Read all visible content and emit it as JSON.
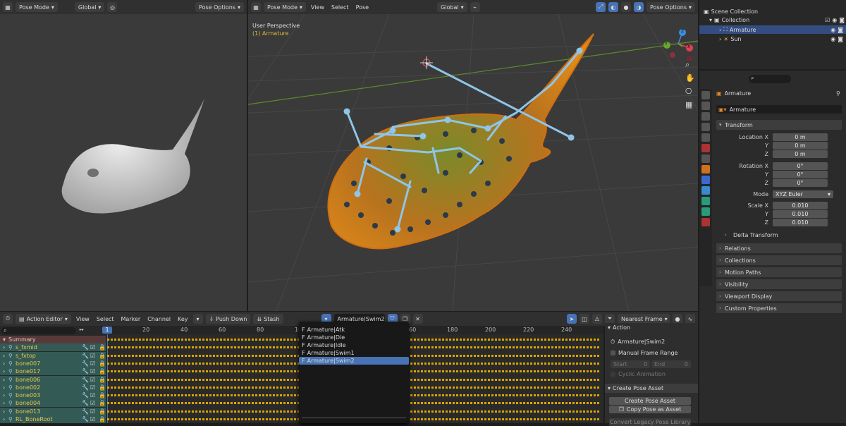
{
  "left_header": {
    "mode": "Pose Mode",
    "orientation": "Global",
    "pose_options": "Pose Options"
  },
  "main_header": {
    "mode": "Pose Mode",
    "menus": [
      "View",
      "Select",
      "Pose"
    ],
    "orientation": "Global",
    "pose_options": "Pose Options"
  },
  "viewport": {
    "perspective": "User Perspective",
    "object": "(1) Armature"
  },
  "gizmo": {
    "x": "X",
    "y": "Y",
    "z": "Z"
  },
  "outliner": {
    "scene_collection": "Scene Collection",
    "collection": "Collection",
    "items": [
      {
        "label": "Armature"
      },
      {
        "label": "Sun"
      }
    ]
  },
  "properties": {
    "object_name": "Armature",
    "data_name": "Armature",
    "transform_title": "Transform",
    "location": {
      "label_x": "Location X",
      "label_y": "Y",
      "label_z": "Z",
      "x": "0 m",
      "y": "0 m",
      "z": "0 m"
    },
    "rotation": {
      "label_x": "Rotation X",
      "label_y": "Y",
      "label_z": "Z",
      "x": "0°",
      "y": "0°",
      "z": "0°"
    },
    "mode_label": "Mode",
    "mode_value": "XYZ Euler",
    "scale": {
      "label_x": "Scale X",
      "label_y": "Y",
      "label_z": "Z",
      "x": "0.010",
      "y": "0.010",
      "z": "0.010"
    },
    "delta_transform": "Delta Transform",
    "panels": [
      "Relations",
      "Collections",
      "Motion Paths",
      "Visibility",
      "Viewport Display",
      "Custom Properties"
    ]
  },
  "action_editor": {
    "editor": "Action Editor",
    "menus": [
      "View",
      "Select",
      "Marker",
      "Channel",
      "Key"
    ],
    "push_down": "Push Down",
    "stash": "Stash",
    "action_name": "Armature|Swim2",
    "snap": "Nearest Frame",
    "current_frame": "1",
    "ticks": [
      "20",
      "40",
      "60",
      "80",
      "10",
      "60",
      "180",
      "200",
      "220",
      "240"
    ],
    "channels": [
      "Summary",
      "s_fxmid",
      "s_fxtop",
      "bone007",
      "bone017",
      "bone006",
      "bone002",
      "bone003",
      "bone004",
      "bone013",
      "RL_BoneRoot"
    ],
    "dropdown": [
      "Armature|Atk",
      "Armature|Die",
      "Armature|Idle",
      "Armature|Swim1",
      "Armature|Swim2"
    ],
    "dropdown_prefix": "F"
  },
  "sidebar": {
    "action_title": "Action",
    "action_name": "Armature|Swim2",
    "manual_range": "Manual Frame Range",
    "start_label": "Start",
    "start_value": "0",
    "end_label": "End",
    "end_value": "0",
    "cyclic": "Cyclic Animation",
    "pose_asset_title": "Create Pose Asset",
    "create_pose": "Create Pose Asset",
    "copy_pose": "Copy Pose as Asset",
    "convert_legacy": "Convert Legacy Pose Library"
  },
  "colors": {
    "accent": "#4772b3",
    "bone": "#8fc5e8",
    "summary": "#573939",
    "channel": "#335a55",
    "keyframe": "#d9a400"
  }
}
